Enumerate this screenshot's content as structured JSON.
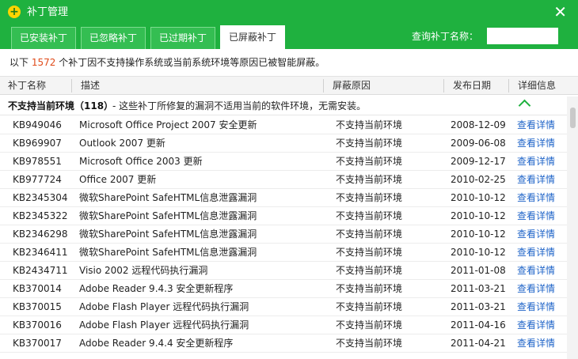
{
  "window": {
    "title": "补丁管理",
    "logo_icon": "plus-circle-icon",
    "close_icon": "close-icon"
  },
  "tabs": [
    {
      "label": "已安装补丁",
      "active": false
    },
    {
      "label": "已忽略补丁",
      "active": false
    },
    {
      "label": "已过期补丁",
      "active": false
    },
    {
      "label": "已屏蔽补丁",
      "active": true
    }
  ],
  "search": {
    "label": "查询补丁名称：",
    "value": ""
  },
  "summary": {
    "prefix": "以下 ",
    "count": "1572",
    "suffix": " 个补丁因不支持操作系统或当前系统环境等原因已被智能屏蔽。"
  },
  "columns": {
    "name": "补丁名称",
    "desc": "描述",
    "reason": "屏蔽原因",
    "date": "发布日期",
    "detail": "详细信息"
  },
  "group": {
    "name": "不支持当前环境（118）",
    "desc": "-  这些补丁所修复的漏洞不适用当前的软件环境，无需安装。"
  },
  "colors": {
    "header_green": "#1fb13f",
    "count_orange": "#e04b1a",
    "link_blue": "#1f64c8"
  },
  "rows": [
    {
      "id": "KB949046",
      "desc": "Microsoft Office Project 2007 安全更新",
      "reason": "不支持当前环境",
      "date": "2008-12-09",
      "link": "查看详情"
    },
    {
      "id": "KB969907",
      "desc": "Outlook 2007 更新",
      "reason": "不支持当前环境",
      "date": "2009-06-08",
      "link": "查看详情"
    },
    {
      "id": "KB978551",
      "desc": "Microsoft Office 2003 更新",
      "reason": "不支持当前环境",
      "date": "2009-12-17",
      "link": "查看详情"
    },
    {
      "id": "KB977724",
      "desc": "Office 2007 更新",
      "reason": "不支持当前环境",
      "date": "2010-02-25",
      "link": "查看详情"
    },
    {
      "id": "KB2345304",
      "desc": "微软SharePoint SafeHTML信息泄露漏洞",
      "reason": "不支持当前环境",
      "date": "2010-10-12",
      "link": "查看详情"
    },
    {
      "id": "KB2345322",
      "desc": "微软SharePoint SafeHTML信息泄露漏洞",
      "reason": "不支持当前环境",
      "date": "2010-10-12",
      "link": "查看详情"
    },
    {
      "id": "KB2346298",
      "desc": "微软SharePoint SafeHTML信息泄露漏洞",
      "reason": "不支持当前环境",
      "date": "2010-10-12",
      "link": "查看详情"
    },
    {
      "id": "KB2346411",
      "desc": "微软SharePoint SafeHTML信息泄露漏洞",
      "reason": "不支持当前环境",
      "date": "2010-10-12",
      "link": "查看详情"
    },
    {
      "id": "KB2434711",
      "desc": "Visio 2002 远程代码执行漏洞",
      "reason": "不支持当前环境",
      "date": "2011-01-08",
      "link": "查看详情"
    },
    {
      "id": "KB370014",
      "desc": "Adobe Reader 9.4.3 安全更新程序",
      "reason": "不支持当前环境",
      "date": "2011-03-21",
      "link": "查看详情"
    },
    {
      "id": "KB370015",
      "desc": "Adobe Flash Player 远程代码执行漏洞",
      "reason": "不支持当前环境",
      "date": "2011-03-21",
      "link": "查看详情"
    },
    {
      "id": "KB370016",
      "desc": "Adobe Flash Player 远程代码执行漏洞",
      "reason": "不支持当前环境",
      "date": "2011-04-16",
      "link": "查看详情"
    },
    {
      "id": "KB370017",
      "desc": "Adobe Reader 9.4.4 安全更新程序",
      "reason": "不支持当前环境",
      "date": "2011-04-21",
      "link": "查看详情"
    }
  ]
}
